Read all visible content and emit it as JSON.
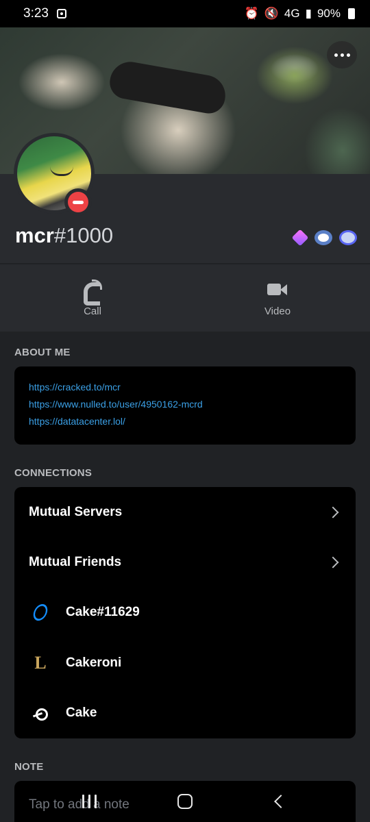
{
  "status_bar": {
    "time": "3:23",
    "signal_label": "4G",
    "battery": "90%"
  },
  "profile": {
    "username": "mcr",
    "discriminator": "#1000",
    "status": "do-not-disturb",
    "badges": [
      "nitro-gem-badge",
      "server-boost-badge",
      "nitro-badge"
    ]
  },
  "actions": {
    "call_label": "Call",
    "video_label": "Video"
  },
  "about_me": {
    "title": "ABOUT ME",
    "links": [
      "https://cracked.to/mcr",
      "https://www.nulled.to/user/4950162-mcrd",
      "https://datatacenter.lol/"
    ]
  },
  "connections": {
    "title": "CONNECTIONS",
    "mutual_servers": "Mutual Servers",
    "mutual_friends": "Mutual Friends",
    "accounts": [
      {
        "service": "battlenet-icon",
        "name": "Cake#11629"
      },
      {
        "service": "league-of-legends-icon",
        "name": "Cakeroni"
      },
      {
        "service": "steam-icon",
        "name": "Cake"
      }
    ]
  },
  "note": {
    "title": "NOTE",
    "placeholder": "Tap to add a note"
  },
  "colors": {
    "background": "#202225",
    "card": "#000000",
    "link": "#3ba0e6",
    "dnd_red": "#ed4245"
  }
}
